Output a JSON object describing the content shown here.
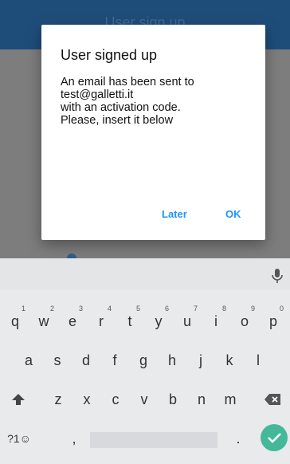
{
  "app": {
    "title": "User sign up"
  },
  "dialog": {
    "title": "User signed up",
    "message": "An email has been sent to\ntest@galletti.it\nwith an activation code.\nPlease, insert it below",
    "later_label": "Later",
    "ok_label": "OK"
  },
  "keyboard": {
    "row1": [
      {
        "k": "q",
        "h": "1"
      },
      {
        "k": "w",
        "h": "2"
      },
      {
        "k": "e",
        "h": "3"
      },
      {
        "k": "r",
        "h": "4"
      },
      {
        "k": "t",
        "h": "5"
      },
      {
        "k": "y",
        "h": "6"
      },
      {
        "k": "u",
        "h": "7"
      },
      {
        "k": "i",
        "h": "8"
      },
      {
        "k": "o",
        "h": "9"
      },
      {
        "k": "p",
        "h": "0"
      }
    ],
    "row2": [
      "a",
      "s",
      "d",
      "f",
      "g",
      "h",
      "j",
      "k",
      "l"
    ],
    "row3": [
      "z",
      "x",
      "c",
      "v",
      "b",
      "n",
      "m"
    ],
    "symbols_label": "?1☺",
    "comma_label": ",",
    "period_label": "."
  },
  "colors": {
    "accent": "#2196f3",
    "appbar": "#1f4d7a",
    "enter": "#45b89a"
  }
}
